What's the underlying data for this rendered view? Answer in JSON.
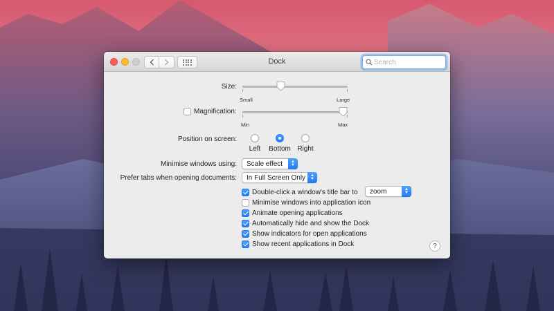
{
  "window": {
    "title": "Dock"
  },
  "toolbar": {
    "back_icon": "chevron-left-icon",
    "forward_icon": "chevron-right-icon",
    "grid_icon": "show-all-grid-icon"
  },
  "search": {
    "placeholder": "Search",
    "value": ""
  },
  "size": {
    "label": "Size:",
    "min_label": "Small",
    "max_label": "Large",
    "value_fraction": 0.35
  },
  "magnification": {
    "label": "Magnification:",
    "checked": false,
    "min_label": "Min",
    "max_label": "Max",
    "value_fraction": 1.0
  },
  "position": {
    "label": "Position on screen:",
    "options": [
      {
        "label": "Left",
        "selected": false
      },
      {
        "label": "Bottom",
        "selected": true
      },
      {
        "label": "Right",
        "selected": false
      }
    ]
  },
  "minimise": {
    "label": "Minimise windows using:",
    "value": "Scale effect"
  },
  "prefer_tabs": {
    "label": "Prefer tabs when opening documents:",
    "value": "In Full Screen Only"
  },
  "checkboxes": [
    {
      "label": "Double-click a window's title bar to",
      "checked": true
    },
    {
      "label": "Minimise windows into application icon",
      "checked": false
    },
    {
      "label": "Animate opening applications",
      "checked": true
    },
    {
      "label": "Automatically hide and show the Dock",
      "checked": true
    },
    {
      "label": "Show indicators for open applications",
      "checked": true
    },
    {
      "label": "Show recent applications in Dock",
      "checked": true
    }
  ],
  "double_click_action": {
    "value": "zoom"
  },
  "help": {
    "label": "?"
  },
  "colors": {
    "accent": "#1f7bf1",
    "window_bg": "#ececec"
  }
}
